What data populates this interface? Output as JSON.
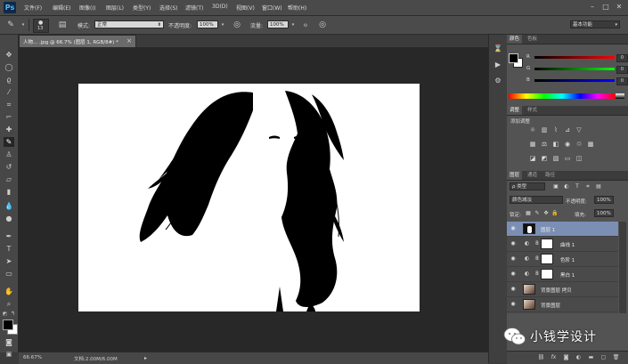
{
  "app": {
    "logo": "Ps"
  },
  "menu": {
    "items": [
      "文件(F)",
      "编辑(E)",
      "图像(I)",
      "图层(L)",
      "类型(Y)",
      "选择(S)",
      "滤镜(T)",
      "3D(D)",
      "视图(V)",
      "窗口(W)",
      "帮助(H)"
    ],
    "window_buttons": [
      "–",
      "□",
      "✕"
    ]
  },
  "options_bar": {
    "brush_size": "13",
    "mode_label": "模式:",
    "mode_value": "正常",
    "opacity_label": "不透明度:",
    "opacity_value": "100%",
    "flow_label": "流量:",
    "flow_value": "100%",
    "workspace": "基本功能"
  },
  "document": {
    "tab_title": "人物... .jpg @ 66.7% (图层 1, RGB/8#) *",
    "close_glyph": "×"
  },
  "status_bar": {
    "zoom": "66.67%",
    "doc_info": "文档:2.00M/6.00M"
  },
  "color_panel": {
    "tabs": [
      "颜色",
      "色板"
    ],
    "channels": [
      {
        "label": "R",
        "value": "0",
        "color": "#ff0000"
      },
      {
        "label": "G",
        "value": "0",
        "color": "#00ff00"
      },
      {
        "label": "B",
        "value": "0",
        "color": "#0000ff"
      }
    ],
    "foreground": "#000000",
    "background": "#ffffff"
  },
  "adjustments_panel": {
    "tabs": [
      "调整",
      "样式"
    ],
    "title": "添加调整"
  },
  "layers_panel": {
    "tabs": [
      "图层",
      "通道",
      "路径"
    ],
    "filter_kind": "ρ 类型",
    "blend_mode": "颜色减淡",
    "opacity_label": "不透明度:",
    "opacity_value": "100%",
    "lock_label": "锁定:",
    "fill_label": "填充:",
    "fill_value": "100%",
    "layers": [
      {
        "name": "图层 1",
        "type": "mask",
        "selected": true
      },
      {
        "name": "曲线 1",
        "type": "adjustment",
        "selected": false
      },
      {
        "name": "色阶 1",
        "type": "adjustment",
        "selected": false
      },
      {
        "name": "黑白 1",
        "type": "adjustment",
        "selected": false
      },
      {
        "name": "背景图层 拷贝",
        "type": "photo",
        "selected": false
      },
      {
        "name": "背景图层",
        "type": "photo",
        "selected": false
      }
    ],
    "footer_icons": [
      "link-icon",
      "fx-icon",
      "mask-icon",
      "adjust-icon",
      "folder-icon",
      "new-layer-icon",
      "trash-icon"
    ]
  },
  "watermark": {
    "text": "小钱学设计"
  }
}
